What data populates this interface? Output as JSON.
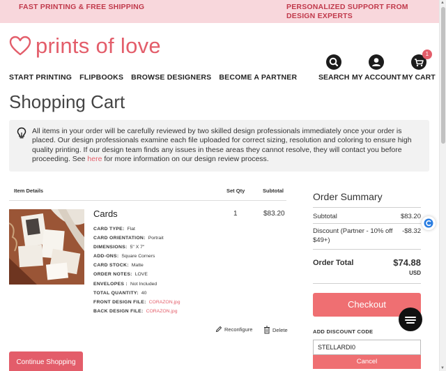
{
  "promo": {
    "left_text": "FAST PRINTING & FREE SHIPPING",
    "right_text": "PERSONALIZED SUPPORT FROM DESIGN EXPERTS"
  },
  "logo": {
    "text": "prints of love",
    "icon": "heart-outline-icon"
  },
  "nav": {
    "items": [
      "START PRINTING",
      "FLIPBOOKS",
      "BROWSE DESIGNERS",
      "BECOME A PARTNER"
    ]
  },
  "header_icons": {
    "search": {
      "label": "SEARCH",
      "icon": "search-icon"
    },
    "account": {
      "label": "MY ACCOUNT",
      "icon": "account-icon"
    },
    "cart": {
      "label": "MY CART",
      "icon": "cart-icon",
      "badge": "1"
    }
  },
  "page": {
    "title": "Shopping Cart"
  },
  "notice": {
    "icon": "lightbulb-icon",
    "text_before": "All items in your order will be carefully reviewed by two skilled design professionals immediately once your order is placed. Our design professionals examine each file uploaded for correct sizing, resolution and coloring to ensure high quality printing. If our design team finds any issues in these areas they cannot resolve, they will contact you before proceeding. See ",
    "link_text": "here",
    "text_after": " for more information on our design review process."
  },
  "cart": {
    "headers": {
      "details": "Item Details",
      "qty": "Set Qty",
      "subtotal": "Subtotal"
    },
    "item": {
      "title": "Cards",
      "qty": "1",
      "price": "$83.20",
      "specs": [
        {
          "label": "CARD TYPE:",
          "value": "Flat"
        },
        {
          "label": "CARD ORIENTATION:",
          "value": "Portrait"
        },
        {
          "label": "DIMENSIONS:",
          "value": "5\" X 7\""
        },
        {
          "label": "ADD-ONS:",
          "value": "Square Corners"
        },
        {
          "label": "CARD STOCK:",
          "value": "Matte"
        },
        {
          "label": "ORDER NOTES:",
          "value": "LOVE"
        },
        {
          "label": "ENVELOPES :",
          "value": "Not Included"
        },
        {
          "label": "TOTAL QUANTITY:",
          "value": "40"
        },
        {
          "label": "FRONT DESIGN FILE:",
          "value": "CORAZON.jpg"
        },
        {
          "label": "BACK DESIGN FILE:",
          "value": "CORAZON.jpg"
        }
      ],
      "reconfigure_label": "Reconfigure",
      "delete_label": "Delete"
    },
    "continue_label": "Continue Shopping"
  },
  "summary": {
    "title": "Order Summary",
    "subtotal_label": "Subtotal",
    "subtotal_value": "$83.20",
    "discount_label": "Discount (Partner - 10% off $49+)",
    "discount_value": "-$8.32",
    "total_label": "Order Total",
    "total_value": "$74.88",
    "currency": "USD",
    "checkout_label": "Checkout",
    "discount_code_label": "ADD DISCOUNT CODE",
    "discount_code_value": "STELLARDI0",
    "cancel_label": "Cancel"
  },
  "colors": {
    "brand": "#e35d6a",
    "promo_bg": "#f8d7dc",
    "button": "#ef6f72",
    "notice_bg": "#f2f2f2"
  }
}
